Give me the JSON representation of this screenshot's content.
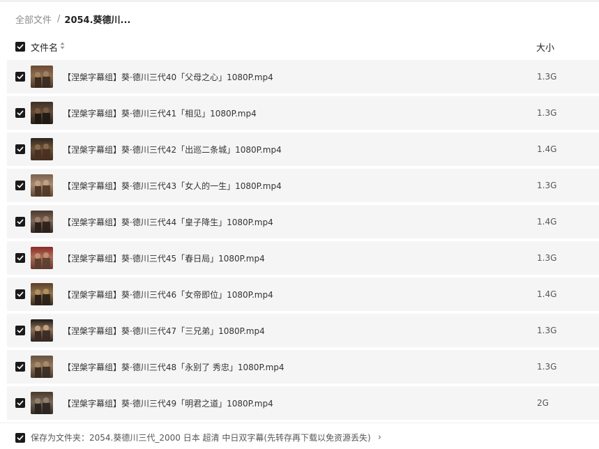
{
  "breadcrumb": {
    "root": "全部文件",
    "separator": "/",
    "current": "2054.葵德川..."
  },
  "header": {
    "name_label": "文件名",
    "size_label": "大小",
    "sort_icon": "sort-updown-icon",
    "select_all_checked": true
  },
  "files": [
    {
      "name": "【涅槃字幕组】葵·德川三代40「父母之心」1080P.mp4",
      "size": "1.3G",
      "checked": true,
      "thumb": [
        "#6b4a33",
        "#a08060",
        "#3a2a20"
      ]
    },
    {
      "name": "【涅槃字幕组】葵·德川三代41「相见」1080P.mp4",
      "size": "1.3G",
      "checked": true,
      "thumb": [
        "#3d3028",
        "#7a5a40",
        "#1e1812"
      ]
    },
    {
      "name": "【涅槃字幕组】葵·德川三代42「出巡二条城」1080P.mp4",
      "size": "1.4G",
      "checked": true,
      "thumb": [
        "#2e2620",
        "#8a6a48",
        "#4a3020"
      ]
    },
    {
      "name": "【涅槃字幕组】葵·德川三代43「女人的一生」1080P.mp4",
      "size": "1.3G",
      "checked": true,
      "thumb": [
        "#7a6050",
        "#c0a080",
        "#503828"
      ]
    },
    {
      "name": "【涅槃字幕组】葵·德川三代44「皇子降生」1080P.mp4",
      "size": "1.4G",
      "checked": true,
      "thumb": [
        "#4a3a30",
        "#9a8068",
        "#2a201a"
      ]
    },
    {
      "name": "【涅槃字幕组】葵·德川三代45「春日局」1080P.mp4",
      "size": "1.3G",
      "checked": true,
      "thumb": [
        "#8a2a2a",
        "#c09070",
        "#5a4030"
      ]
    },
    {
      "name": "【涅槃字幕组】葵·德川三代46「女帝即位」1080P.mp4",
      "size": "1.4G",
      "checked": true,
      "thumb": [
        "#5a4028",
        "#b09060",
        "#2a2018"
      ]
    },
    {
      "name": "【涅槃字幕组】葵·德川三代47「三兄弟」1080P.mp4",
      "size": "1.3G",
      "checked": true,
      "thumb": [
        "#1e1a18",
        "#c8a080",
        "#3a2a22"
      ]
    },
    {
      "name": "【涅槃字幕组】葵·德川三代48「永别了 秀忠」1080P.mp4",
      "size": "1.3G",
      "checked": true,
      "thumb": [
        "#6a5240",
        "#a88a6a",
        "#3a2c22"
      ]
    },
    {
      "name": "【涅槃字幕组】葵·德川三代49「明君之道」1080P.mp4",
      "size": "2G",
      "checked": true,
      "thumb": [
        "#4a3a2a",
        "#908070",
        "#2a2420"
      ]
    }
  ],
  "footer": {
    "save_label": "保存为文件夹：2054.葵德川三代_2000 日本 超清 中日双字幕(先转存再下载以免资源丢失)",
    "arrow": "›",
    "checked": true
  }
}
